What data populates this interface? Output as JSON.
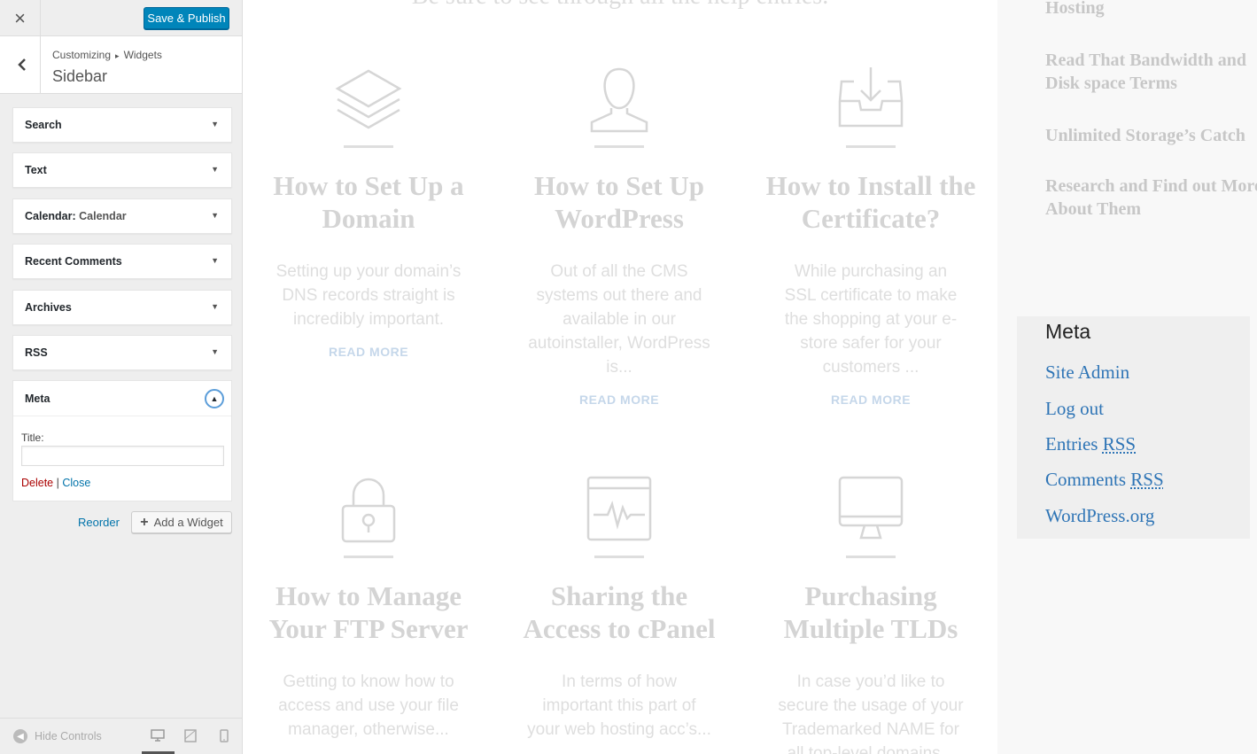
{
  "customizer": {
    "close_icon": "×",
    "save_label": "Save & Publish",
    "back_icon": "‹",
    "breadcrumb": {
      "root": "Customizing",
      "sep": "▸",
      "current": "Widgets"
    },
    "section_title": "Sidebar",
    "widgets": [
      {
        "label": "Search"
      },
      {
        "label": "Text"
      },
      {
        "label": "Calendar:",
        "sub": "Calendar"
      },
      {
        "label": "Recent Comments"
      },
      {
        "label": "Archives"
      },
      {
        "label": "RSS"
      }
    ],
    "arrow_down": "▼",
    "meta_widget": {
      "label": "Meta",
      "toggle_icon": "▲",
      "title_label": "Title:",
      "title_value": "",
      "delete_label": "Delete",
      "separator": "|",
      "close_label": "Close"
    },
    "reorder_label": "Reorder",
    "add_widget_label": "Add a Widget",
    "add_icon": "+",
    "footer": {
      "hide_controls_label": "Hide Controls",
      "devices": [
        "desktop-icon",
        "tablet-icon",
        "mobile-icon"
      ]
    }
  },
  "preview": {
    "top_heading": "Be sure to see through all the help entries.",
    "cards": [
      {
        "icon": "layers-icon",
        "title": "How to Set Up a Domain",
        "text": "Setting up your domain’s DNS records straight is incredibly important.",
        "read_more": "READ MORE"
      },
      {
        "icon": "user-icon",
        "title": "How to Set Up WordPress",
        "text": "Out of all the CMS systems out there and available in our autoinstaller, WordPress is...",
        "read_more": "READ MORE"
      },
      {
        "icon": "inbox-download-icon",
        "title": "How to Install the Certificate?",
        "text": "While purchasing an SSL certificate to make the shopping at your e-store safer for your customers ...",
        "read_more": "READ MORE"
      },
      {
        "icon": "lock-icon",
        "title": "How to Manage Your FTP Server",
        "text": "Getting to know how to access and use your file manager, otherwise...",
        "read_more": ""
      },
      {
        "icon": "browser-pulse-icon",
        "title": "Sharing the Access to cPanel",
        "text": "In terms of how important this part of your web hosting acc’s...",
        "read_more": ""
      },
      {
        "icon": "monitor-icon",
        "title": "Purchasing Multiple TLDs",
        "text": "In case you’d like to secure the usage of your Trademarked NAME for all top-level domains...",
        "read_more": ""
      }
    ],
    "recent_posts": [
      "Hosting",
      "Read That Bandwidth and Disk space Terms",
      "Unlimited Storage’s Catch",
      "Research and Find out More About Them"
    ],
    "meta": {
      "title": "Meta",
      "links": [
        {
          "text": "Site Admin"
        },
        {
          "text": "Log out"
        },
        {
          "text": "Entries ",
          "abbr": "RSS"
        },
        {
          "text": "Comments ",
          "abbr": "RSS"
        },
        {
          "text": "WordPress.org"
        }
      ]
    },
    "colors": {
      "link": "#2f75b6",
      "primary_button": "#0085ba",
      "delete": "#a00"
    }
  }
}
